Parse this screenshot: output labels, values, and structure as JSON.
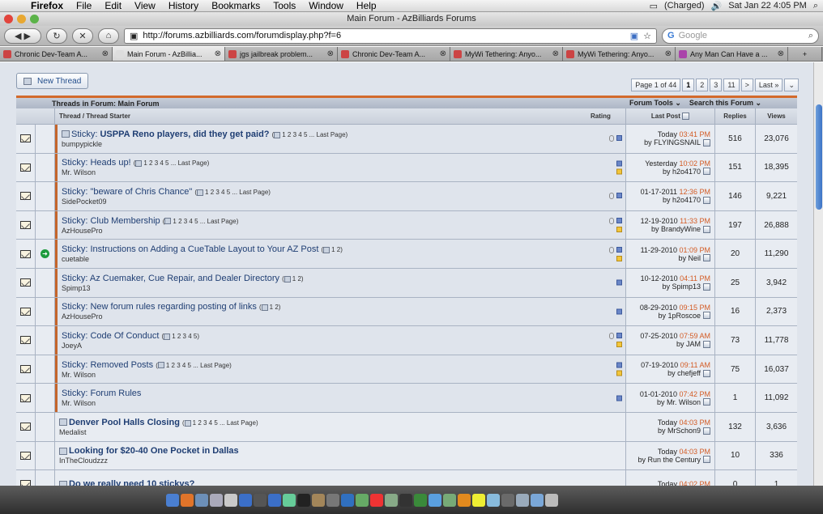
{
  "menubar": {
    "items": [
      "Firefox",
      "File",
      "Edit",
      "View",
      "History",
      "Bookmarks",
      "Tools",
      "Window",
      "Help"
    ],
    "battery": "(Charged)",
    "clock": "Sat Jan 22  4:05 PM"
  },
  "window": {
    "title": "Main Forum - AzBilliards Forums"
  },
  "toolbar": {
    "url": "http://forums.azbilliards.com/forumdisplay.php?f=6",
    "search_placeholder": "Google"
  },
  "tabs": [
    {
      "label": "Chronic Dev-Team A...",
      "active": false
    },
    {
      "label": "Main Forum - AzBillia...",
      "active": true
    },
    {
      "label": "jgs jailbreak problem...",
      "active": false
    },
    {
      "label": "Chronic Dev-Team A...",
      "active": false
    },
    {
      "label": "MyWi Tethering: Anyo...",
      "active": false
    },
    {
      "label": "MyWi Tethering: Anyo...",
      "active": false
    },
    {
      "label": "Any Man Can Have a ...",
      "active": false
    }
  ],
  "forum": {
    "new_thread_label": "New Thread",
    "page_label": "Page 1 of 44",
    "pages": [
      "1",
      "2",
      "3",
      "11",
      ">",
      "Last »"
    ],
    "header_title": "Threads in Forum: Main Forum",
    "forum_tools": "Forum Tools",
    "search_forum": "Search this Forum"
  },
  "columns": {
    "thread": "Thread / Thread Starter",
    "rating": "Rating",
    "last_post": "Last Post",
    "replies": "Replies",
    "views": "Views"
  },
  "threads": [
    {
      "prefix": "Sticky:",
      "title": "USPPA Reno players, did they get paid?",
      "bold": true,
      "pages": "1 2 3 4 5 ... Last Page",
      "starter": "bumpypickle",
      "date": "Today",
      "time": "03:41 PM",
      "by": "by FLYINGSNAIL",
      "replies": "516",
      "views": "23,076",
      "sticky": true
    },
    {
      "prefix": "Sticky:",
      "title": "Heads up!",
      "bold": false,
      "pages": "1 2 3 4 5 ... Last Page",
      "starter": "Mr. Wilson",
      "date": "Yesterday",
      "time": "10:02 PM",
      "by": "by h2o4170",
      "replies": "151",
      "views": "18,395",
      "sticky": true
    },
    {
      "prefix": "Sticky:",
      "title": "\"beware of Chris Chance\"",
      "bold": false,
      "pages": "1 2 3 4 5 ... Last Page",
      "starter": "SidePocket09",
      "date": "01-17-2011",
      "time": "12:36 PM",
      "by": "by h2o4170",
      "replies": "146",
      "views": "9,221",
      "sticky": true
    },
    {
      "prefix": "Sticky:",
      "title": "Club Membership",
      "bold": false,
      "pages": "1 2 3 4 5 ... Last Page",
      "starter": "AzHousePro",
      "date": "12-19-2010",
      "time": "11:33 PM",
      "by": "by BrandyWine",
      "replies": "197",
      "views": "26,888",
      "sticky": true
    },
    {
      "prefix": "Sticky:",
      "title": "Instructions on Adding a CueTable Layout to Your AZ Post",
      "bold": false,
      "pages": "1 2",
      "starter": "cuetable",
      "date": "11-29-2010",
      "time": "01:09 PM",
      "by": "by Neil",
      "replies": "20",
      "views": "11,290",
      "sticky": true
    },
    {
      "prefix": "Sticky:",
      "title": "Az Cuemaker, Cue Repair, and Dealer Directory",
      "bold": false,
      "pages": "1 2",
      "starter": "Spimp13",
      "date": "10-12-2010",
      "time": "04:11 PM",
      "by": "by Spimp13",
      "replies": "25",
      "views": "3,942",
      "sticky": true
    },
    {
      "prefix": "Sticky:",
      "title": "New forum rules regarding posting of links",
      "bold": false,
      "pages": "1 2",
      "starter": "AzHousePro",
      "date": "08-29-2010",
      "time": "09:15 PM",
      "by": "by 1pRoscoe",
      "replies": "16",
      "views": "2,373",
      "sticky": true
    },
    {
      "prefix": "Sticky:",
      "title": "Code Of Conduct",
      "bold": false,
      "pages": "1 2 3 4 5",
      "starter": "JoeyA",
      "date": "07-25-2010",
      "time": "07:59 AM",
      "by": "by JAM",
      "replies": "73",
      "views": "11,778",
      "sticky": true
    },
    {
      "prefix": "Sticky:",
      "title": "Removed Posts",
      "bold": false,
      "pages": "1 2 3 4 5 ... Last Page",
      "starter": "Mr. Wilson",
      "date": "07-19-2010",
      "time": "09:11 AM",
      "by": "by chefjeff",
      "replies": "75",
      "views": "16,037",
      "sticky": true
    },
    {
      "prefix": "Sticky:",
      "title": "Forum Rules",
      "bold": false,
      "pages": "",
      "starter": "Mr. Wilson",
      "date": "01-01-2010",
      "time": "07:42 PM",
      "by": "by Mr. Wilson",
      "replies": "1",
      "views": "11,092",
      "sticky": true
    },
    {
      "prefix": "",
      "title": "Denver Pool Halls Closing",
      "bold": true,
      "pages": "1 2 3 4 5 ... Last Page",
      "starter": "Medalist",
      "date": "Today",
      "time": "04:03 PM",
      "by": "by MrSchon9",
      "replies": "132",
      "views": "3,636",
      "sticky": false
    },
    {
      "prefix": "",
      "title": "Looking for $20-40 One Pocket in Dallas",
      "bold": true,
      "pages": "",
      "starter": "InTheCloudzzz",
      "date": "Today",
      "time": "04:03 PM",
      "by": "by Run the Century",
      "replies": "10",
      "views": "336",
      "sticky": false
    },
    {
      "prefix": "",
      "title": "Do we really need 10 stickys?",
      "bold": true,
      "pages": "",
      "starter": "",
      "date": "Today",
      "time": "04:02 PM",
      "by": "",
      "replies": "0",
      "views": "1",
      "sticky": false
    }
  ],
  "colors": {
    "accent": "#d36a2c",
    "link": "#1f3e73",
    "time": "#d35b24"
  }
}
